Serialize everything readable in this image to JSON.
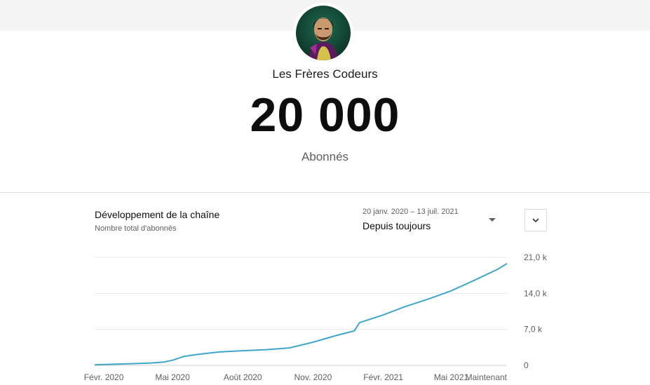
{
  "channel": {
    "name": "Les Frères Codeurs",
    "subscriber_count": "20 000",
    "subscriber_label": "Abonnés"
  },
  "chart_card": {
    "title": "Développement de la chaîne",
    "subtitle": "Nombre total d'abonnés",
    "date_range": "20 janv. 2020 – 13 juil. 2021",
    "range_selected": "Depuis toujours",
    "expand_icon": "chevron-down-icon",
    "range_icon": "caret-down-icon"
  },
  "colors": {
    "line": "#3ea6c9",
    "grid": "#e5e5e5",
    "top_band": "#f4f4f4"
  },
  "chart_data": {
    "type": "line",
    "title": "Développement de la chaîne",
    "subtitle": "Nombre total d'abonnés",
    "x_tick_labels": [
      "Févr. 2020",
      "Mai 2020",
      "Août 2020",
      "Nov. 2020",
      "Févr. 2021",
      "Mai 2021",
      "Maintenant"
    ],
    "x_tick_dates": [
      "2020-02-01",
      "2020-05-01",
      "2020-08-01",
      "2020-11-01",
      "2021-02-01",
      "2021-05-01",
      "2021-07-13"
    ],
    "y_tick_labels": [
      "0",
      "7,0 k",
      "14,0 k",
      "21,0 k"
    ],
    "y_tick_values": [
      0,
      7000,
      14000,
      21000
    ],
    "ylim": [
      0,
      21000
    ],
    "xlim": [
      "2020-01-20",
      "2021-07-13"
    ],
    "grid": true,
    "series": [
      {
        "x": [
          "2020-01-20",
          "2020-02-01",
          "2020-03-01",
          "2020-04-01",
          "2020-04-20",
          "2020-05-01",
          "2020-05-15",
          "2020-06-01",
          "2020-07-01",
          "2020-08-01",
          "2020-09-01",
          "2020-10-01",
          "2020-11-01",
          "2020-12-01",
          "2020-12-25",
          "2021-01-01",
          "2021-02-01",
          "2021-03-01",
          "2021-04-01",
          "2021-05-01",
          "2021-06-01",
          "2021-07-01",
          "2021-07-13"
        ],
        "y": [
          100,
          180,
          280,
          450,
          650,
          1000,
          1700,
          2100,
          2600,
          2850,
          3050,
          3400,
          4500,
          5800,
          6700,
          8300,
          9800,
          11400,
          12900,
          14500,
          16600,
          18700,
          19800
        ]
      }
    ]
  }
}
